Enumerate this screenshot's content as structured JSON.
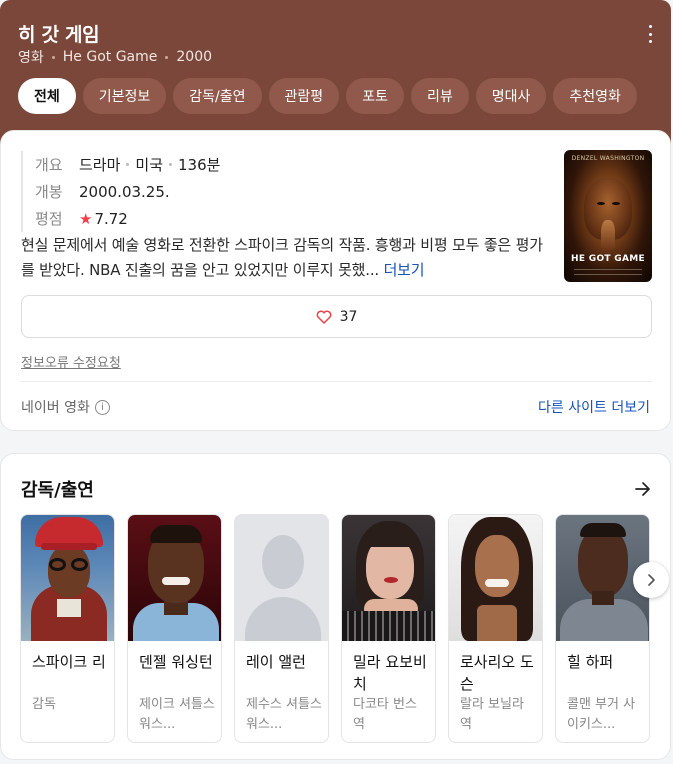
{
  "header": {
    "title": "히 갓 게임",
    "meta": [
      "영화",
      "He Got Game",
      "2000"
    ],
    "tabs": [
      {
        "label": "전체",
        "active": true
      },
      {
        "label": "기본정보",
        "active": false
      },
      {
        "label": "감독/출연",
        "active": false
      },
      {
        "label": "관람평",
        "active": false
      },
      {
        "label": "포토",
        "active": false
      },
      {
        "label": "리뷰",
        "active": false
      },
      {
        "label": "명대사",
        "active": false
      },
      {
        "label": "추천영화",
        "active": false
      }
    ]
  },
  "info": {
    "overview_label": "개요",
    "overview": [
      "드라마",
      "미국",
      "136분"
    ],
    "release_label": "개봉",
    "release": "2000.03.25.",
    "rating_label": "평점",
    "rating": "7.72",
    "poster": {
      "top_text": "DENZEL WASHINGTON",
      "title_text": "HE GOT GAME"
    },
    "description": "현실 문제에서 예술 영화로 전환한 스파이크 감독의 작품. 흥행과 비평 모두 좋은 평가를 받았다. NBA 진출의 꿈을 안고 있었지만 이루지 못했...",
    "more_label": "더보기",
    "likes": "37",
    "report_label": "정보오류 수정요청",
    "source_label": "네이버 영화",
    "other_sites_label": "다른 사이트 더보기"
  },
  "cast": {
    "title": "감독/출연",
    "people": [
      {
        "name": "스파이크 리",
        "role": "감독"
      },
      {
        "name": "덴젤 워싱턴",
        "role": "제이크 셔틀스워스..."
      },
      {
        "name": "레이 앨런",
        "role": "제수스 셔틀스워스..."
      },
      {
        "name": "밀라 요보비치",
        "role": "다코타 번스 역"
      },
      {
        "name": "로사리오 도슨",
        "role": "랄라 보닐라 역"
      },
      {
        "name": "힐 하퍼",
        "role": "콜맨 부거 사이키스..."
      }
    ]
  },
  "colors": {
    "header_bg": "#7b473a",
    "tab_bg": "#90594c",
    "link": "#1453b8",
    "star": "#f0414b"
  }
}
